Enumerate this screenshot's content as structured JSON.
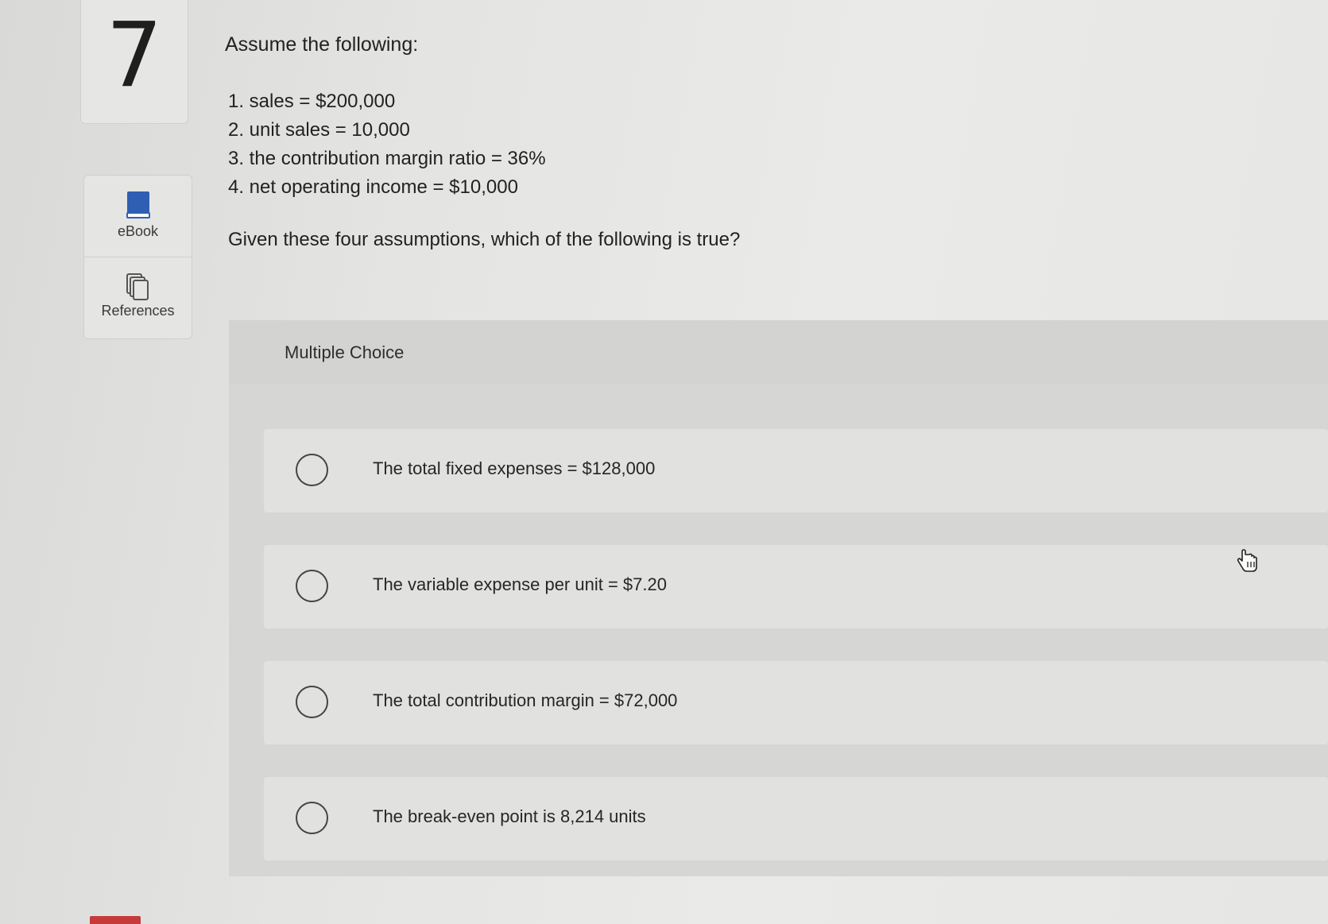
{
  "question": {
    "number": "7",
    "intro": "Assume the following:",
    "assumptions": [
      "1. sales = $200,000",
      "2. unit sales = 10,000",
      "3. the contribution margin ratio = 36%",
      "4. net operating income = $10,000"
    ],
    "prompt": "Given these four assumptions, which of the following is true?"
  },
  "tools": {
    "ebook": {
      "label": "eBook",
      "icon": "book-icon",
      "color": "#2f5fb3"
    },
    "references": {
      "label": "References",
      "icon": "copy-icon"
    }
  },
  "multiple_choice": {
    "title": "Multiple Choice",
    "options": [
      {
        "text": "The total fixed expenses = $128,000",
        "selected": false
      },
      {
        "text": "The variable expense per unit = $7.20",
        "selected": false
      },
      {
        "text": "The total contribution margin = $72,000",
        "selected": false
      },
      {
        "text": "The break-even point is 8,214 units",
        "selected": false
      }
    ]
  }
}
